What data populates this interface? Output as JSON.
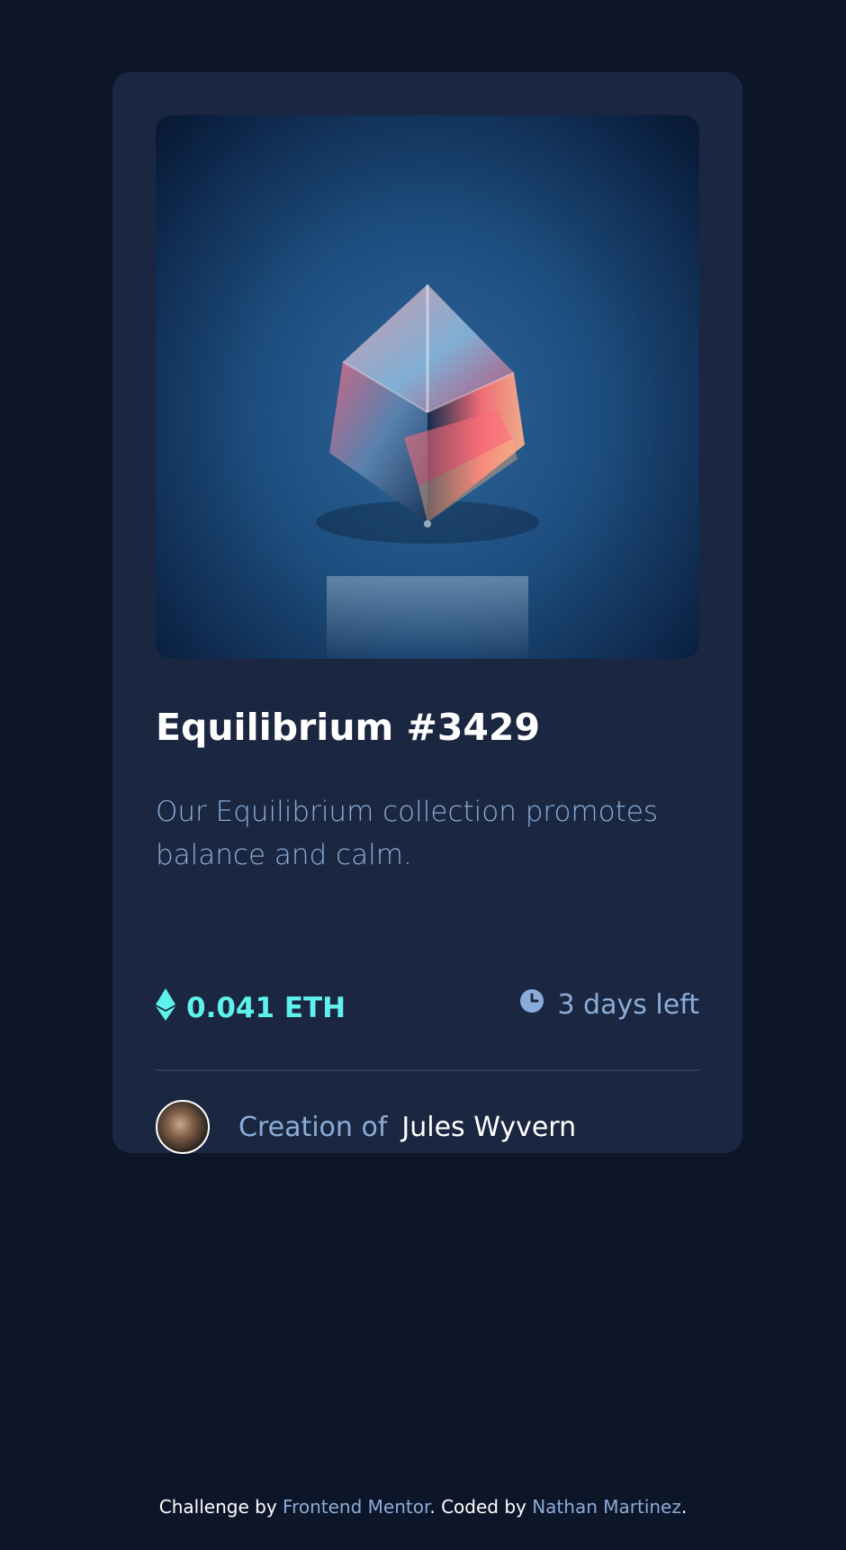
{
  "card": {
    "title": "Equilibrium #3429",
    "description": "Our Equilibrium collection promotes balance and calm.",
    "price": "0.041 ETH",
    "time_left": "3 days left",
    "creator_label": "Creation of",
    "creator_name": "Jules Wyvern"
  },
  "icons": {
    "price": "ethereum-icon",
    "time": "clock-icon"
  },
  "footer": {
    "prefix": "Challenge by ",
    "challenge_link": "Frontend Mentor",
    "middle": ". Coded by ",
    "author_link": "Nathan Martinez",
    "suffix": "."
  },
  "colors": {
    "background": "#0d1628",
    "card": "#1b2740",
    "accent_cyan": "#5ff1eb",
    "soft_blue": "#8bacd9",
    "white": "#ffffff"
  }
}
